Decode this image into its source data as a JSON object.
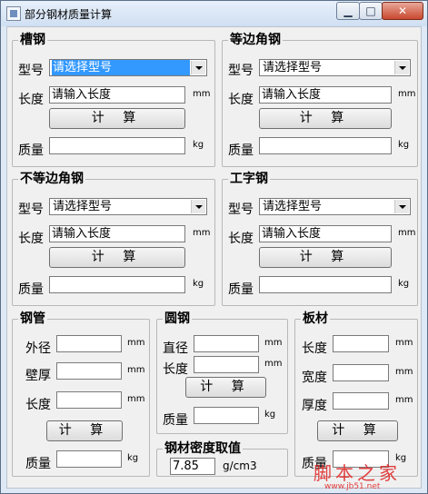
{
  "window": {
    "title": "部分钢材质量计算",
    "min_glyph": "▁",
    "max_glyph": "□",
    "close_glyph": "✕"
  },
  "channel": {
    "title": "槽钢",
    "type_label": "型号",
    "type_value": "请选择型号",
    "length_label": "长度",
    "length_placeholder": "请输入长度",
    "length_unit": "mm",
    "calc_label": "计 算",
    "mass_label": "质量",
    "mass_value": "",
    "mass_unit": "kg"
  },
  "equal_angle": {
    "title": "等边角钢",
    "type_label": "型号",
    "type_value": "请选择型号",
    "length_label": "长度",
    "length_placeholder": "请输入长度",
    "length_unit": "mm",
    "calc_label": "计 算",
    "mass_label": "质量",
    "mass_value": "",
    "mass_unit": "kg"
  },
  "unequal_angle": {
    "title": "不等边角钢",
    "type_label": "型号",
    "type_value": "请选择型号",
    "length_label": "长度",
    "length_placeholder": "请输入长度",
    "length_unit": "mm",
    "calc_label": "计 算",
    "mass_label": "质量",
    "mass_value": "",
    "mass_unit": "kg"
  },
  "i_beam": {
    "title": "工字钢",
    "type_label": "型号",
    "type_value": "请选择型号",
    "length_label": "长度",
    "length_placeholder": "请输入长度",
    "length_unit": "mm",
    "calc_label": "计 算",
    "mass_label": "质量",
    "mass_value": "",
    "mass_unit": "kg"
  },
  "pipe": {
    "title": "钢管",
    "outer_label": "外径",
    "outer_value": "",
    "outer_unit": "mm",
    "wall_label": "壁厚",
    "wall_value": "",
    "wall_unit": "mm",
    "length_label": "长度",
    "length_value": "",
    "length_unit": "mm",
    "calc_label": "计 算",
    "mass_label": "质量",
    "mass_value": "",
    "mass_unit": "kg"
  },
  "round_bar": {
    "title": "圆钢",
    "diameter_label": "直径",
    "diameter_value": "",
    "diameter_unit": "mm",
    "length_label": "长度",
    "length_value": "",
    "length_unit": "mm",
    "calc_label": "计 算",
    "mass_label": "质量",
    "mass_value": "",
    "mass_unit": "kg"
  },
  "plate": {
    "title": "板材",
    "length_label": "长度",
    "length_value": "",
    "length_unit": "mm",
    "width_label": "宽度",
    "width_value": "",
    "width_unit": "mm",
    "thickness_label": "厚度",
    "thickness_value": "",
    "thickness_unit": "mm",
    "calc_label": "计 算",
    "mass_label": "质量",
    "mass_value": "",
    "mass_unit": "kg"
  },
  "density": {
    "title": "钢材密度取值",
    "value": "7.85",
    "unit": "g/cm3"
  },
  "watermark": {
    "logo": "脚本之家",
    "url": "www.jb51.net"
  }
}
